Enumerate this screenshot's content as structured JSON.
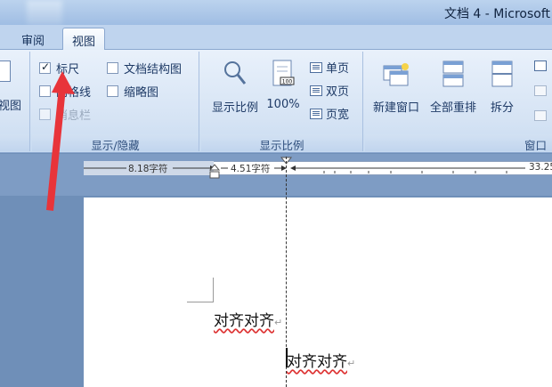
{
  "window": {
    "title": "文档 4 - Microsoft"
  },
  "tabs": [
    {
      "label": "审阅",
      "active": false
    },
    {
      "label": "视图",
      "active": true
    }
  ],
  "ribbon": {
    "left_partial_button": {
      "label": "视图"
    },
    "show_hide": {
      "label": "显示/隐藏",
      "ruler": {
        "label": "标尺",
        "checked": true
      },
      "gridlines": {
        "label": "网格线",
        "checked": false
      },
      "message_bar": {
        "label": "消息栏",
        "checked": false,
        "disabled": true
      },
      "doc_map": {
        "label": "文档结构图",
        "checked": false
      },
      "thumbnails": {
        "label": "缩略图",
        "checked": false
      }
    },
    "zoom": {
      "label": "显示比例",
      "zoom_button": "显示比例",
      "hundred_button": "100%",
      "hundred_icon_text": "100",
      "one_page": "单页",
      "two_pages": "双页",
      "page_width": "页宽"
    },
    "window_group": {
      "label": "窗口",
      "new_window": "新建窗口",
      "arrange_all": "全部重排",
      "split": "拆分"
    }
  },
  "ruler": {
    "left_indent_text": "8.18字符",
    "first_indent_text": "4.51字符",
    "right_text": "33.25"
  },
  "document": {
    "line1": "对齐对齐",
    "line2": "对齐对齐"
  },
  "colors": {
    "annotation_arrow": "#e8343a",
    "ribbon_bg": "#d5e3f4",
    "ruler_band": "#7e9cc4"
  }
}
